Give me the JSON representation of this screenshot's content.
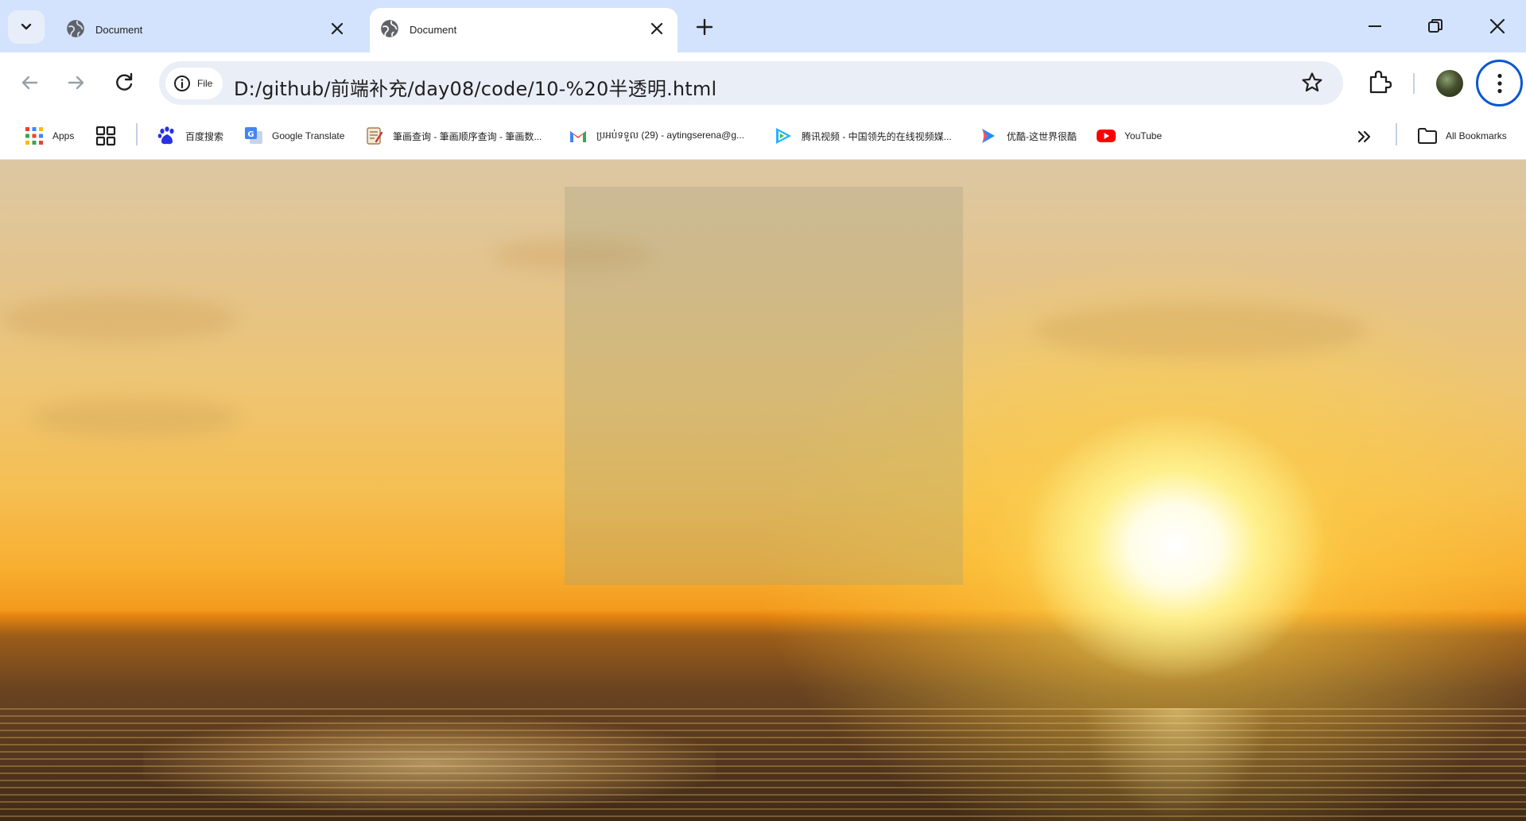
{
  "tabs": [
    {
      "title": "Document",
      "active": false
    },
    {
      "title": "Document",
      "active": true
    }
  ],
  "omnibox": {
    "chip_label": "File",
    "url": "D:/github/前端补充/day08/code/10-%20半透明.html"
  },
  "bookmarks": [
    {
      "label": "Apps",
      "icon": "apps-grid-icon"
    },
    {
      "label": "",
      "icon": "tab-groups-icon"
    },
    {
      "label": "百度搜索",
      "icon": "baidu-paw-icon"
    },
    {
      "label": "Google Translate",
      "icon": "google-translate-icon"
    },
    {
      "label": "筆画查询 - 筆画顺序查询 - 筆画数...",
      "icon": "notepad-icon"
    },
    {
      "label": "ប្រអប់ទទួល (29) - aytingserena@g...",
      "icon": "gmail-icon"
    },
    {
      "label": "腾讯视频 - 中国领先的在线视频媒...",
      "icon": "tencent-video-icon"
    },
    {
      "label": "优酷-这世界很酷",
      "icon": "youku-icon"
    },
    {
      "label": "YouTube",
      "icon": "youtube-icon"
    }
  ],
  "all_bookmarks_label": "All Bookmarks",
  "colors": {
    "tabstrip_bg": "#d3e3fd",
    "omnibox_bg": "#eaeef7",
    "menu_ring": "#0b57d0",
    "box_overlay": "rgba(160,160,130,0.30)"
  }
}
